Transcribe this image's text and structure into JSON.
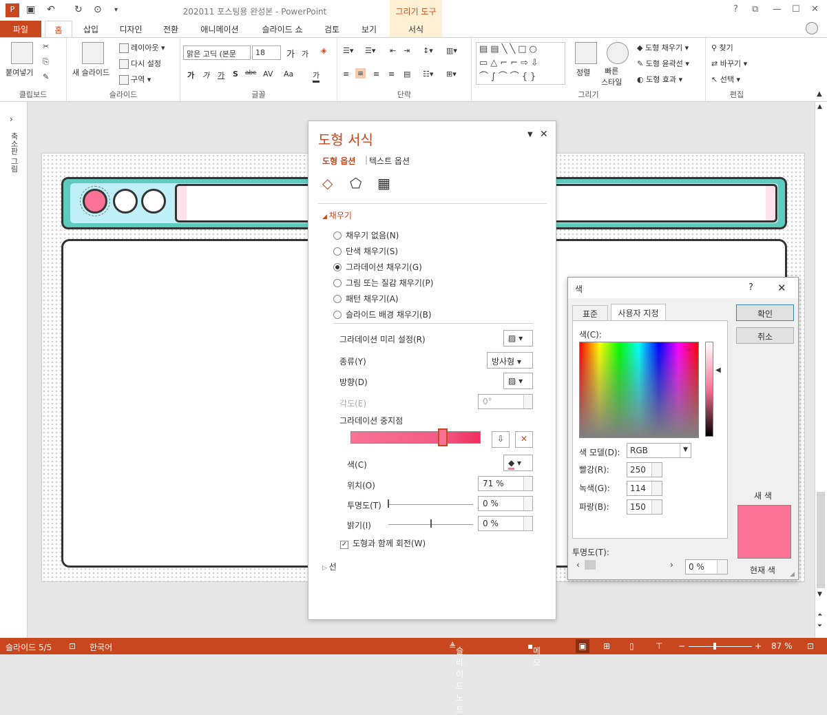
{
  "titlebar": {
    "title": "202011 포스팅용 완성본 - PowerPoint",
    "context_tab": "그리기 도구",
    "help": "?",
    "minimize": "—",
    "maximize": "☐",
    "close": "✕"
  },
  "tabs": [
    "파일",
    "홈",
    "삽입",
    "디자인",
    "전환",
    "애니메이션",
    "슬라이드 쇼",
    "검토",
    "보기",
    "서식"
  ],
  "ribbon": {
    "clipboard": {
      "paste": "붙여넣기",
      "label": "클립보드"
    },
    "slides": {
      "new_slide": "새 슬라이드",
      "layout": "레이아웃",
      "reset": "다시 설정",
      "section": "구역",
      "label": "슬라이드"
    },
    "font": {
      "font_name": "맑은 고딕 (본문",
      "font_size": "18",
      "label": "글꼴",
      "grow": "가",
      "shrink": "가",
      "bold": "가",
      "italic": "가",
      "underline": "가",
      "shadow": "S",
      "strike": "abc",
      "spacing": "AV",
      "case": "Aa",
      "color": "가"
    },
    "paragraph": {
      "label": "단락"
    },
    "drawing": {
      "arrange": "정렬",
      "quick_styles": "빠른\n스타일",
      "fill": "도형 채우기",
      "outline": "도형 윤곽선",
      "effects": "도형 효과",
      "label": "그리기"
    },
    "editing": {
      "find": "찾기",
      "replace": "바꾸기",
      "select": "선택",
      "label": "편집"
    }
  },
  "thumbstrip": {
    "label": "축소판 그림"
  },
  "pane": {
    "title": "도형 서식",
    "opt_shape": "도형 옵션",
    "opt_text": "텍스트 옵션",
    "fill_section": "채우기",
    "fill_options": [
      "채우기 없음(N)",
      "단색 채우기(S)",
      "그라데이션 채우기(G)",
      "그림 또는 질감 채우기(P)",
      "패턴 채우기(A)",
      "슬라이드 배경 채우기(B)"
    ],
    "preset_label": "그라데이션 미리 설정(R)",
    "type_label": "종류(Y)",
    "type_value": "방사형",
    "direction_label": "방향(D)",
    "angle_label": "각도(E)",
    "angle_value": "0°",
    "stops_label": "그라데이션 중지점",
    "color_label": "색(C)",
    "position_label": "위치(O)",
    "position_value": "71 %",
    "transparency_label": "투명도(T)",
    "transparency_value": "0 %",
    "brightness_label": "밝기(I)",
    "brightness_value": "0 %",
    "rotate_label": "도형과 함께 회전(W)",
    "line_section": "선"
  },
  "color_dialog": {
    "title": "색",
    "help": "?",
    "close": "✕",
    "tab_standard": "표준",
    "tab_custom": "사용자 지정",
    "colors_label": "색(C):",
    "model_label": "색 모델(D):",
    "model_value": "RGB",
    "red_label": "빨강(R):",
    "red_value": "250",
    "green_label": "녹색(G):",
    "green_value": "114",
    "blue_label": "파랑(B):",
    "blue_value": "150",
    "transparency_label": "투명도(T):",
    "transparency_value": "0 %",
    "ok": "확인",
    "cancel": "취소",
    "new_label": "새 색",
    "current_label": "현재 색",
    "new_color": "#fa7296"
  },
  "status": {
    "slide": "슬라이드 5/5",
    "language": "한국어",
    "notes": "슬라이드 노트",
    "comments": "메모",
    "zoom": "87 %"
  },
  "colors": {
    "accent": "#c8471f",
    "teal": "#5fcbbd",
    "pink": "#fa7296"
  }
}
